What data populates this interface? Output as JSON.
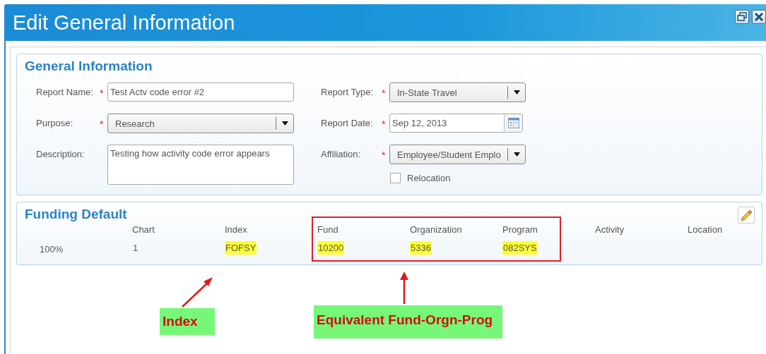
{
  "window": {
    "title": "Edit General Information"
  },
  "general_information": {
    "heading": "General Information",
    "left_fields": [
      {
        "kind": "text",
        "label": "Report Name:",
        "required_mark": "*",
        "value": "Test Actv code error #2"
      },
      {
        "kind": "dropdown",
        "label": "Purpose:",
        "required_mark": "*",
        "value": "Research"
      },
      {
        "kind": "textarea",
        "label": "Description:",
        "value": "Testing how activity code error appears"
      }
    ],
    "right_fields": [
      {
        "kind": "dropdown",
        "label": "Report Type:",
        "required_mark": "*",
        "value": "In-State Travel"
      },
      {
        "kind": "date",
        "label": "Report Date:",
        "required_mark": "*",
        "value": "Sep 12, 2013"
      },
      {
        "kind": "dropdown",
        "label": "Affiliation:",
        "required_mark": "*",
        "value": "Employee/Student Emplo"
      },
      {
        "kind": "checkbox",
        "label": "Relocation",
        "checked": false
      }
    ]
  },
  "funding_default": {
    "heading": "Funding Default",
    "columns": [
      {
        "label": "Chart"
      },
      {
        "label": "Index"
      },
      {
        "label": "Fund",
        "outlined": true
      },
      {
        "label": "Organization",
        "outlined": true
      },
      {
        "label": "Program",
        "outlined": true
      },
      {
        "label": "Activity"
      },
      {
        "label": "Location"
      }
    ],
    "rows": [
      {
        "percent": "100%",
        "cells": [
          {
            "text": "1",
            "highlighted": false
          },
          {
            "text": "FOFSY",
            "highlighted": true
          },
          {
            "text": "10200",
            "highlighted": true
          },
          {
            "text": "5336",
            "highlighted": true
          },
          {
            "text": "082SYS",
            "highlighted": true
          }
        ]
      }
    ]
  },
  "annotations": [
    {
      "label": "Index",
      "kind": "diagonal"
    },
    {
      "label": "Equivalent Fund-Orgn-Prog",
      "kind": "vertical"
    }
  ]
}
